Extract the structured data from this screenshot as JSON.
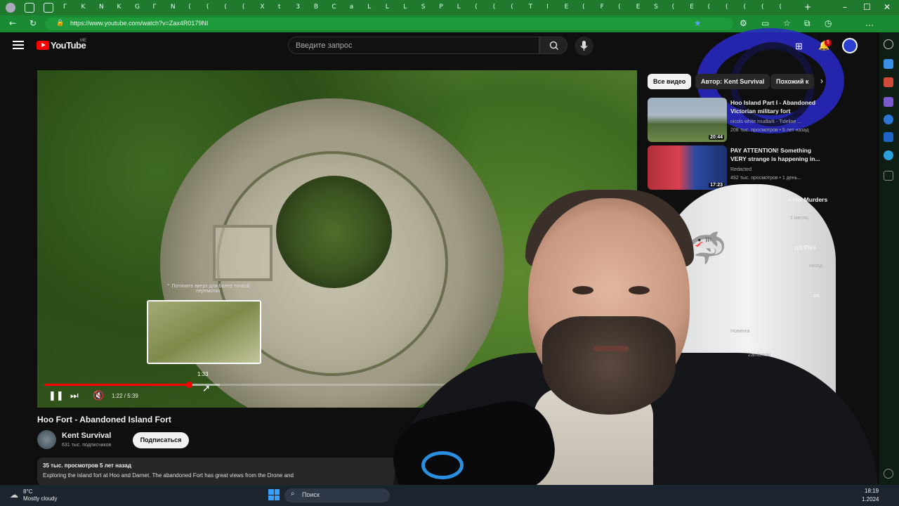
{
  "browser": {
    "tab_glyphs": [
      "Г",
      "K",
      "N",
      "K",
      "G",
      "Г",
      "N",
      "(",
      "(",
      "(",
      "(",
      "X",
      "t",
      "3",
      "B",
      "C",
      "a",
      "L",
      "L",
      "L",
      "S",
      "P",
      "L",
      "(",
      "(",
      "(",
      "T",
      "I",
      "E",
      "(",
      "F",
      "(",
      "E",
      "S",
      "(",
      "E",
      "(",
      "(",
      "(",
      "(",
      "("
    ],
    "url": "https://www.youtube.com/watch?v=Zax4R0179NI",
    "new_tab": "+",
    "minimize": "–",
    "maximize": "☐",
    "close": "✕"
  },
  "youtube": {
    "logo_text": "YouTube",
    "country_code": "ME",
    "search_placeholder": "Введите запрос",
    "notification_count": "5"
  },
  "player": {
    "seek_hint": "⌃ Потяните вверх для более точной перемотки",
    "hover_time": "1:33",
    "time_display": "1:22 / 5:39",
    "played_fraction": 0.247,
    "buffered_fraction": 0.3
  },
  "video": {
    "title": "Hoo Fort - Abandoned Island Fort",
    "channel_name": "Kent Survival",
    "channel_subs": "631 тыс. подписчиков",
    "subscribe_label": "Подписаться",
    "views_age": "35 тыс. просмотров  5 лет назад",
    "description": "Exploring the island fort at Hoo and Darnet. The abandoned Fort has great views from the Drone and"
  },
  "sidebar": {
    "chips": [
      "Все видео",
      "Автор: Kent Survival",
      "Похожий к"
    ],
    "items": [
      {
        "title": "Hoo Island Part I - Abandoned Victorian military fort",
        "channel": "nicols white mudlark - Tideline ...",
        "meta": "208 тыс. просмотров • 5 лет назад",
        "duration": "20:44"
      },
      {
        "title": "PAY ATTENTION! Something VERY strange is happening in...",
        "channel": "Redacted",
        "meta": "492 тыс. просмотров • 1 день...",
        "duration": "17:23"
      }
    ],
    "partials": [
      {
        "title": "s His Murders",
        "meta": "1 месяц"
      },
      {
        "title": "ort Pike",
        "meta": "назад"
      },
      {
        "title": "ак",
        "meta": ""
      },
      {
        "title": "Thorn Island",
        "meta": "Новинка",
        "channel": "Zambinski"
      }
    ]
  },
  "taskbar": {
    "temp": "8°C",
    "weather": "Mostly cloudy",
    "search_label": "Поиск",
    "time": "18:19",
    "date": "1.2024"
  },
  "colors": {
    "browser_green": "#1f7a2e",
    "yt_red": "#ff0000",
    "bg": "#0f0f0f"
  }
}
